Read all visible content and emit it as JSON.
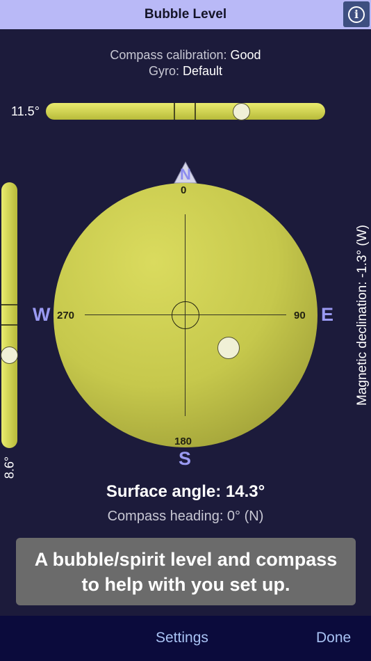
{
  "navbar": {
    "title": "Bubble Level",
    "info_icon": "info-icon",
    "info_glyph": "i"
  },
  "status": {
    "calibration_label": "Compass calibration:",
    "calibration_value": "Good",
    "gyro_label": "Gyro:",
    "gyro_value": "Default"
  },
  "horizontal_level": {
    "value": "11.5°"
  },
  "vertical_level": {
    "value": "8.6°"
  },
  "compass": {
    "north_marker": "N",
    "deg_north": "0",
    "deg_east": "90",
    "deg_south": "180",
    "deg_west": "270",
    "cardinal_west": "W",
    "cardinal_east": "E",
    "cardinal_south": "S"
  },
  "declination": "Magnetic declination: -1.3° (W)",
  "readings": {
    "surface_angle": "Surface angle: 14.3°",
    "compass_heading": "Compass heading: 0° (N)"
  },
  "caption": "A bubble/spirit level and compass\nto help with you set up.",
  "toolbar": {
    "settings_label": "Settings",
    "done_label": "Done"
  },
  "colors": {
    "accent": "#b9b9f7",
    "level_yellow": "#d8da5a",
    "background": "#1c1b3b",
    "cardinal": "#9a9af2",
    "toolbar_text": "#a9c3f4"
  }
}
